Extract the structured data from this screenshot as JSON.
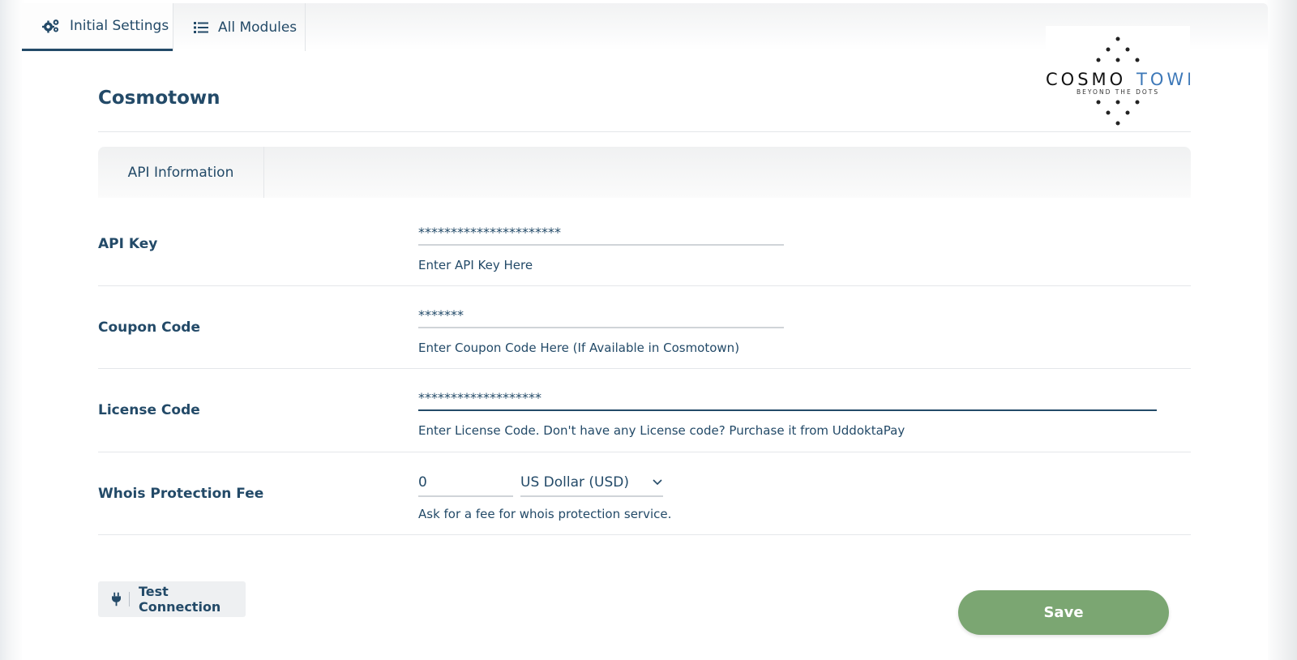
{
  "tabs": [
    {
      "label": "Initial Settings",
      "icon": "gears-icon",
      "active": true
    },
    {
      "label": "All Modules",
      "icon": "list-icon",
      "active": false
    }
  ],
  "logo": {
    "word_dark": "COSMO",
    "word_accent": "TOWN",
    "tagline": "BEYOND THE DOTS",
    "accent_color": "#3d78b8"
  },
  "page": {
    "title": "Cosmotown"
  },
  "subtabs": [
    {
      "label": "API Information"
    }
  ],
  "fields": {
    "api_key": {
      "label": "API Key",
      "value": "**********************",
      "help": "Enter API Key Here"
    },
    "coupon_code": {
      "label": "Coupon Code",
      "value": "*******",
      "help": "Enter Coupon Code Here (If Available in Cosmotown)"
    },
    "license_code": {
      "label": "License Code",
      "value": "*******************",
      "help": "Enter License Code. Don't have any License code? Purchase it from UddoktaPay"
    },
    "whois_fee": {
      "label": "Whois Protection Fee",
      "value": "0",
      "currency": "US Dollar (USD)",
      "help": "Ask for a fee for whois protection service."
    }
  },
  "buttons": {
    "test_connection": "Test Connection",
    "save": "Save"
  },
  "colors": {
    "primary_text": "#234a68",
    "save_button": "#7ba672",
    "field_line": "#d0d4d8"
  }
}
